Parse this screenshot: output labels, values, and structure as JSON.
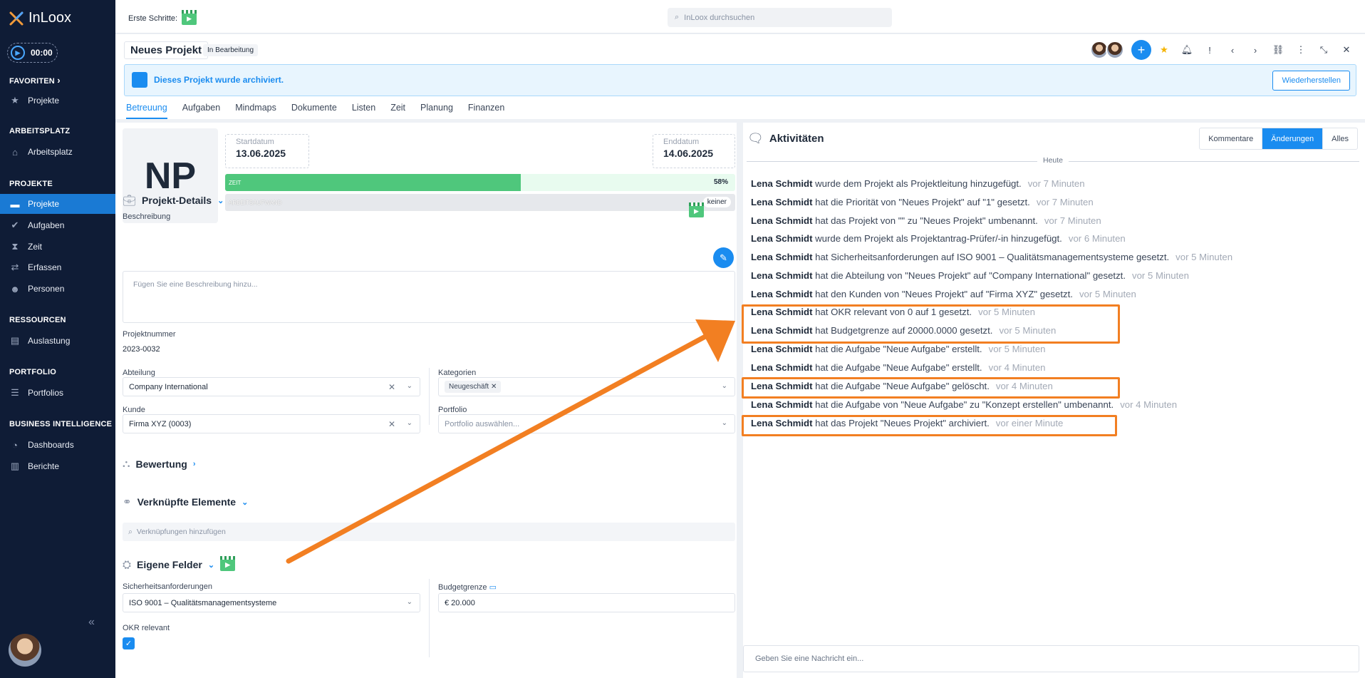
{
  "app": {
    "name": "InLoox",
    "timer": "00:00"
  },
  "sidebar": {
    "sections": [
      {
        "head": "FAVORITEN",
        "chevron": "›",
        "items": [
          {
            "label": "Projekte",
            "icon": "star-icon"
          }
        ]
      },
      {
        "head": "ARBEITSPLATZ",
        "items": [
          {
            "label": "Arbeitsplatz",
            "icon": "home-icon"
          }
        ]
      },
      {
        "head": "PROJEKTE",
        "items": [
          {
            "label": "Projekte",
            "icon": "folder-icon",
            "active": true
          },
          {
            "label": "Aufgaben",
            "icon": "check-circle-icon"
          },
          {
            "label": "Zeit",
            "icon": "hourglass-icon"
          },
          {
            "label": "Erfassen",
            "icon": "capture-icon"
          },
          {
            "label": "Personen",
            "icon": "person-icon"
          }
        ]
      },
      {
        "head": "RESSOURCEN",
        "items": [
          {
            "label": "Auslastung",
            "icon": "workload-icon"
          }
        ]
      },
      {
        "head": "PORTFOLIO",
        "items": [
          {
            "label": "Portfolios",
            "icon": "portfolio-icon"
          }
        ]
      },
      {
        "head": "BUSINESS INTELLIGENCE",
        "items": [
          {
            "label": "Dashboards",
            "icon": "dashboard-icon"
          },
          {
            "label": "Berichte",
            "icon": "report-icon"
          }
        ]
      }
    ],
    "collapse": "«"
  },
  "topbar": {
    "first_steps": "Erste Schritte:",
    "search_placeholder": "InLoox durchsuchen"
  },
  "header": {
    "title": "Neues Projekt",
    "status": "In Bearbeitung",
    "banner_text": "Dieses Projekt wurde archiviert.",
    "restore_label": "Wiederherstellen",
    "tabs": [
      "Betreuung",
      "Aufgaben",
      "Mindmaps",
      "Dokumente",
      "Listen",
      "Zeit",
      "Planung",
      "Finanzen"
    ]
  },
  "project": {
    "initials": "NP",
    "start_label": "Startdatum",
    "start_value": "13.06.2025",
    "end_label": "Enddatum",
    "end_value": "14.06.2025",
    "time_label": "ZEIT",
    "time_percent": "58%",
    "time_fraction": 0.58,
    "effort_label": "ARBEITSAUFWAND",
    "effort_value": "keiner"
  },
  "details": {
    "section_title": "Projekt-Details",
    "description_label": "Beschreibung",
    "description_placeholder": "Fügen Sie eine Beschreibung hinzu...",
    "number_label": "Projektnummer",
    "number_value": "2023-0032",
    "department_label": "Abteilung",
    "department_value": "Company International",
    "categories_label": "Kategorien",
    "category_chip": "Neugeschäft",
    "customer_label": "Kunde",
    "customer_value": "Firma XYZ (0003)",
    "portfolio_label": "Portfolio",
    "portfolio_placeholder": "Portfolio auswählen..."
  },
  "rating": {
    "title": "Bewertung"
  },
  "linked": {
    "title": "Verknüpfte Elemente",
    "placeholder": "Verknüpfungen hinzufügen"
  },
  "custom": {
    "title": "Eigene Felder",
    "security_label": "Sicherheitsanforderungen",
    "security_value": "ISO 9001 – Qualitätsmanagementsysteme",
    "budget_label": "Budgetgrenze",
    "budget_value": "€ 20.000",
    "okr_label": "OKR relevant",
    "okr_checked": true
  },
  "activities": {
    "title": "Aktivitäten",
    "filters": [
      "Kommentare",
      "Änderungen",
      "Alles"
    ],
    "active_filter": "Änderungen",
    "day_label": "Heute",
    "rows": [
      {
        "user": "Lena Schmidt",
        "text": "wurde dem Projekt als Projektleitung hinzugefügt.",
        "time": "vor 7 Minuten"
      },
      {
        "user": "Lena Schmidt",
        "text": "hat die Priorität von \"Neues Projekt\" auf \"1\" gesetzt.",
        "time": "vor 7 Minuten"
      },
      {
        "user": "Lena Schmidt",
        "text": "hat das Projekt von \"\" zu \"Neues Projekt\" umbenannt.",
        "time": "vor 7 Minuten"
      },
      {
        "user": "Lena Schmidt",
        "text": "wurde dem Projekt als Projektantrag-Prüfer/-in hinzugefügt.",
        "time": "vor 6 Minuten"
      },
      {
        "user": "Lena Schmidt",
        "text": "hat Sicherheitsanforderungen auf ISO 9001 – Qualitätsmanagementsysteme gesetzt.",
        "time": "vor 5 Minuten"
      },
      {
        "user": "Lena Schmidt",
        "text": "hat die Abteilung von \"Neues Projekt\" auf \"Company International\" gesetzt.",
        "time": "vor 5 Minuten"
      },
      {
        "user": "Lena Schmidt",
        "text": " hat den Kunden von \"Neues Projekt\" auf \"Firma XYZ\" gesetzt.",
        "time": "vor 5 Minuten"
      },
      {
        "user": "Lena Schmidt",
        "text": "hat OKR relevant von 0 auf 1 gesetzt.",
        "time": "vor 5 Minuten"
      },
      {
        "user": "Lena Schmidt",
        "text": "hat Budgetgrenze auf 20000.0000 gesetzt.",
        "time": "vor 5 Minuten"
      },
      {
        "user": "Lena Schmidt",
        "text": "hat die Aufgabe \"Neue Aufgabe\" erstellt.",
        "time": "vor 5 Minuten"
      },
      {
        "user": "Lena Schmidt",
        "text": "hat die Aufgabe \"Neue Aufgabe\" erstellt.",
        "time": "vor 4 Minuten"
      },
      {
        "user": "Lena Schmidt",
        "text": "hat die Aufgabe \"Neue Aufgabe\" gelöscht.",
        "time": "vor 4 Minuten"
      },
      {
        "user": "Lena Schmidt",
        "text": "hat die Aufgabe von \"Neue Aufgabe\" zu \"Konzept erstellen\" umbenannt.",
        "time": "vor 4 Minuten"
      },
      {
        "user": "Lena Schmidt",
        "text": "hat das Projekt \"Neues Projekt\" archiviert.",
        "time": "vor einer Minute"
      }
    ],
    "message_placeholder": "Geben Sie eine Nachricht ein..."
  },
  "colors": {
    "accent": "#1a8cf0",
    "sidebar": "#0f1c36",
    "highlight": "#f27f22",
    "progress": "#4fc77c"
  }
}
